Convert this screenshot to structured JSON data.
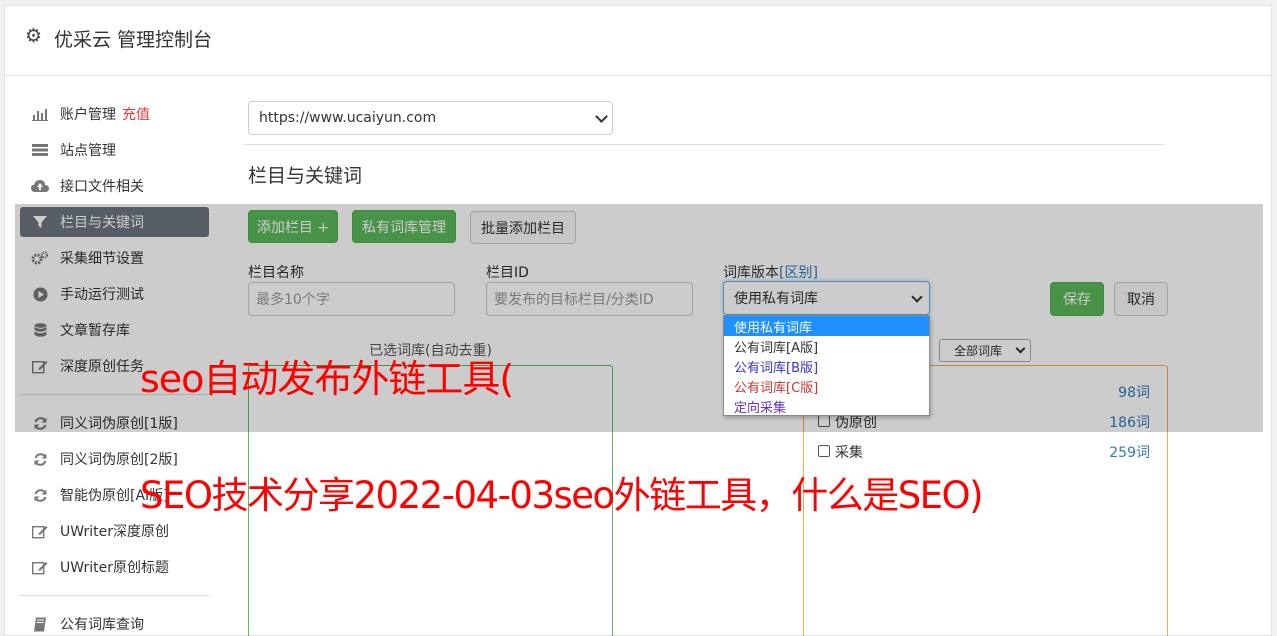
{
  "header": {
    "title": "优采云 管理控制台",
    "icon": "gear-icon"
  },
  "sidebar": {
    "items": [
      {
        "label": "账户管理",
        "extra": "充值",
        "icon": "bar-chart-icon"
      },
      {
        "label": "站点管理",
        "icon": "server-icon"
      },
      {
        "label": "接口文件相关",
        "icon": "cloud-upload-icon"
      },
      {
        "label": "栏目与关键词",
        "icon": "filter-icon",
        "active": true
      },
      {
        "label": "采集细节设置",
        "icon": "gears-icon"
      },
      {
        "label": "手动运行测试",
        "icon": "play-circle-icon"
      },
      {
        "label": "文章暂存库",
        "icon": "database-icon"
      },
      {
        "label": "深度原创任务",
        "icon": "edit-icon"
      },
      {
        "label": "同义词伪原创[1版]",
        "icon": "refresh-icon"
      },
      {
        "label": "同义词伪原创[2版]",
        "icon": "refresh-icon"
      },
      {
        "label": "智能伪原创[AI版]",
        "icon": "refresh-icon"
      },
      {
        "label": "UWriter深度原创",
        "icon": "edit-icon"
      },
      {
        "label": "UWriter原创标题",
        "icon": "edit-icon"
      },
      {
        "label": "公有词库查询",
        "icon": "book-icon"
      }
    ]
  },
  "main": {
    "site_select": "https://www.ucaiyun.com",
    "section_title": "栏目与关键词",
    "buttons": {
      "add_column": "添加栏目 +",
      "private_lib": "私有词库管理",
      "batch_add": "批量添加栏目",
      "save": "保存",
      "cancel": "取消"
    },
    "fields": {
      "name_label": "栏目名称",
      "name_placeholder": "最多10个字",
      "id_label": "栏目ID",
      "id_placeholder": "要发布的目标栏目/分类ID",
      "lib_label": "词库版本",
      "lib_link": "[区别]",
      "lib_value": "使用私有词库"
    },
    "dropdown_options": [
      {
        "label": "使用私有词库",
        "color": "#ffffff",
        "selected": true
      },
      {
        "label": "公有词库[A版]",
        "color": "#333333"
      },
      {
        "label": "公有词库[B版]",
        "color": "#3333cc"
      },
      {
        "label": "公有词库[C版]",
        "color": "#cc3333"
      },
      {
        "label": "定向采集",
        "color": "#6633cc"
      }
    ],
    "selected_panel_title": "已选词库(自动去重)",
    "all_libs_select": "全部词库",
    "libs": [
      {
        "label": "",
        "count": "98词"
      },
      {
        "label": "伪原创",
        "count": "186词"
      },
      {
        "label": "采集",
        "count": "259词"
      }
    ]
  },
  "watermark": {
    "line1": "seo自动发布外链工具(",
    "line2": "SEO技术分享2022-04-03seo外链工具，什么是SEO)"
  }
}
